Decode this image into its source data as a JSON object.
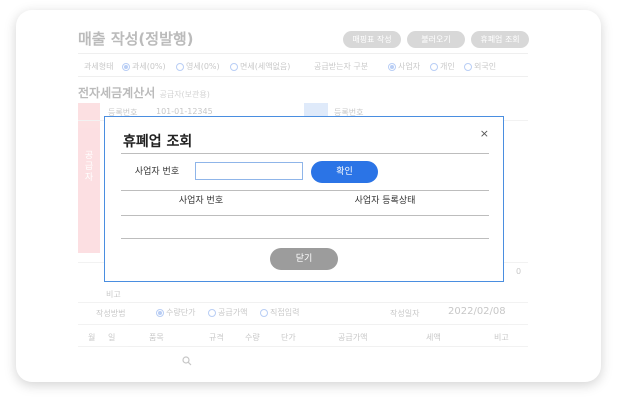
{
  "page": {
    "title": "매출 작성(정발행)",
    "buttons": [
      "매핑표 작성",
      "불러오기",
      "휴폐업 조회"
    ]
  },
  "tax_row": {
    "label": "과세형태",
    "options": [
      "과세(0%)",
      "영세(0%)",
      "면세(세액없음)"
    ],
    "receiver_label": "공급받는자 구분",
    "receiver_options": [
      "사업자",
      "개인",
      "외국인"
    ]
  },
  "invoice": {
    "title": "전자세금계산서",
    "subtitle": "공급자(보관용)",
    "reg_label": "등록번호",
    "reg_value": "101-01-12345",
    "reg_label_right": "등록번호",
    "supplier_vertical": "공급자",
    "total_value": "0",
    "memo_label": "비고"
  },
  "write_row": {
    "label": "작성방법",
    "options": [
      "수량단가",
      "공급가액",
      "직접입력"
    ],
    "date_label": "작성일자",
    "date_value": "2022/02/08"
  },
  "items_header": [
    "월",
    "일",
    "품목",
    "규격",
    "수량",
    "단가",
    "공급가액",
    "세액",
    "비고"
  ],
  "modal": {
    "title": "휴폐업 조회",
    "close_icon": "×",
    "field_label": "사업자 번호",
    "field_value": "",
    "confirm_label": "확인",
    "table_headers": [
      "사업자 번호",
      "사업자 등록상태"
    ],
    "close_label": "닫기"
  }
}
